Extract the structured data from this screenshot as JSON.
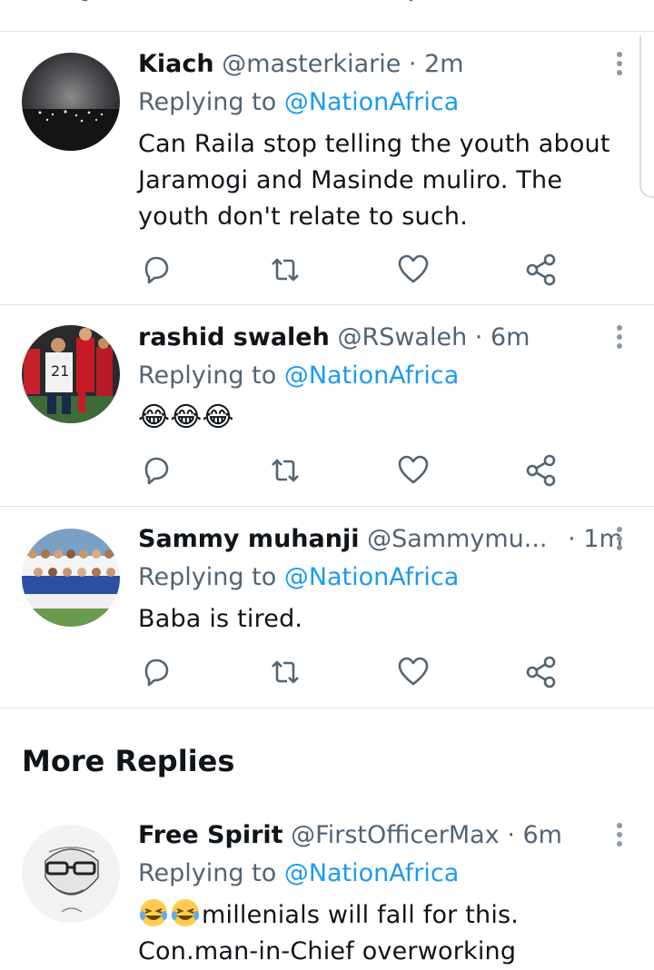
{
  "tweets": [
    {
      "name": "Kiach",
      "handle": "@masterkiarie",
      "separator": "·",
      "time": "2m",
      "reply_prefix": "Replying to",
      "reply_to": "@NationAfrica",
      "text": "Can Raila stop telling the youth about Jaramogi and Masinde muliro. The youth don't relate to such."
    },
    {
      "name": "rashid swaleh",
      "handle": "@RSwaleh",
      "separator": "·",
      "time": "6m",
      "reply_prefix": "Replying to",
      "reply_to": "@NationAfrica",
      "text": "😂😂😂"
    },
    {
      "name": "Sammy muhanji",
      "handle": "@Sammymu...",
      "separator": "·",
      "time": "1m",
      "reply_prefix": "Replying to",
      "reply_to": "@NationAfrica",
      "text": "Baba is tired."
    },
    {
      "name": "Free Spirit",
      "handle": "@FirstOfficerMax",
      "separator": "·",
      "time": "6m",
      "reply_prefix": "Replying to",
      "reply_to": "@NationAfrica",
      "text_line1": "millenials will fall for this.",
      "text_line2": "Con.man-in-Chief overworking"
    }
  ],
  "section": {
    "more_replies": "More Replies"
  },
  "icons": [
    "reply-icon",
    "retweet-icon",
    "like-icon",
    "share-icon",
    "more-options-icon"
  ],
  "colors": {
    "link": "#1d9bf0",
    "secondary_text": "#536471",
    "divider": "#e1e4e6",
    "icon": "#536471"
  }
}
